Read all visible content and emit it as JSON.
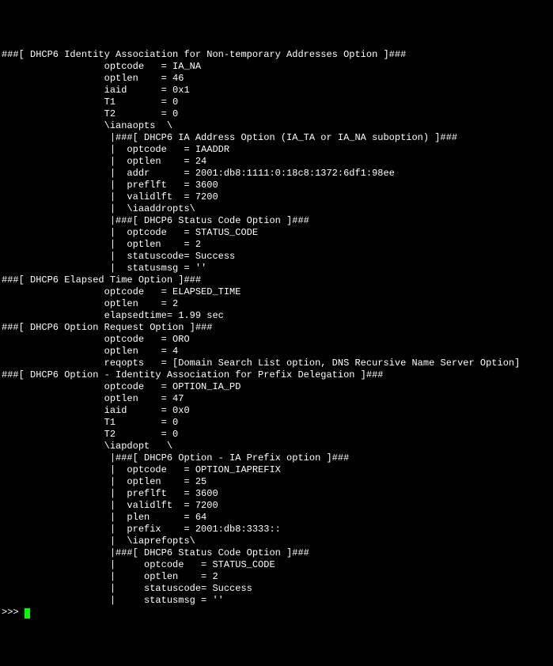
{
  "lines": [
    "###[ DHCP6 Identity Association for Non-temporary Addresses Option ]###",
    "                  optcode   = IA_NA",
    "                  optlen    = 46",
    "                  iaid      = 0x1",
    "                  T1        = 0",
    "                  T2        = 0",
    "                  \\ianaopts  \\",
    "                   |###[ DHCP6 IA Address Option (IA_TA or IA_NA suboption) ]###",
    "                   |  optcode   = IAADDR",
    "                   |  optlen    = 24",
    "                   |  addr      = 2001:db8:1111:0:18c8:1372:6df1:98ee",
    "                   |  preflft   = 3600",
    "                   |  validlft  = 7200",
    "                   |  \\iaaddropts\\",
    "                   |###[ DHCP6 Status Code Option ]###",
    "                   |  optcode   = STATUS_CODE",
    "                   |  optlen    = 2",
    "                   |  statuscode= Success",
    "                   |  statusmsg = ''",
    "###[ DHCP6 Elapsed Time Option ]###",
    "                  optcode   = ELAPSED_TIME",
    "                  optlen    = 2",
    "                  elapsedtime= 1.99 sec",
    "###[ DHCP6 Option Request Option ]###",
    "                  optcode   = ORO",
    "                  optlen    = 4",
    "                  reqopts   = [Domain Search List option, DNS Recursive Name Server Option]",
    "###[ DHCP6 Option - Identity Association for Prefix Delegation ]###",
    "                  optcode   = OPTION_IA_PD",
    "                  optlen    = 47",
    "                  iaid      = 0x0",
    "                  T1        = 0",
    "                  T2        = 0",
    "                  \\iapdopt   \\",
    "                   |###[ DHCP6 Option - IA Prefix option ]###",
    "                   |  optcode   = OPTION_IAPREFIX",
    "                   |  optlen    = 25",
    "                   |  preflft   = 3600",
    "                   |  validlft  = 7200",
    "                   |  plen      = 64",
    "                   |  prefix    = 2001:db8:3333::",
    "                   |  \\iaprefopts\\",
    "                   |###[ DHCP6 Status Code Option ]###",
    "                   |     optcode   = STATUS_CODE",
    "                   |     optlen    = 2",
    "                   |     statuscode= Success",
    "                   |     statusmsg = ''"
  ],
  "prompt": ">>> "
}
